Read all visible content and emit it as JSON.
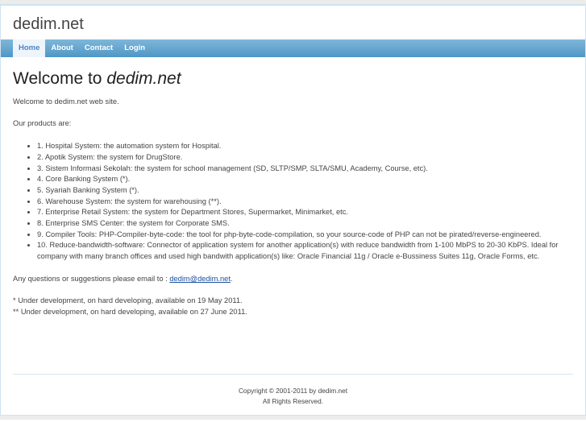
{
  "site": {
    "title": "dedim.net"
  },
  "nav": [
    {
      "label": "Home",
      "active": true
    },
    {
      "label": "About"
    },
    {
      "label": "Contact"
    },
    {
      "label": "Login"
    }
  ],
  "page": {
    "heading_prefix": "Welcome to",
    "heading_em": "dedim.net",
    "intro": "Welcome to dedim.net web site.",
    "products_label": "Our products are:",
    "products": [
      "1. Hospital System: the automation system for Hospital.",
      "2. Apotik System: the system for DrugStore.",
      "3. Sistem Informasi Sekolah: the system for school management (SD, SLTP/SMP, SLTA/SMU, Academy, Course, etc).",
      "4. Core Banking System (*).",
      "5. Syariah Banking System (*).",
      "6. Warehouse System: the system for warehousing (**).",
      "7. Enterprise Retail System: the system for Department Stores, Supermarket, Minimarket, etc.",
      "8. Enterprise SMS Center: the system for Corporate SMS.",
      "9. Compiler Tools: PHP-Compiler-byte-code: the tool for php-byte-code-compilation, so your source-code of PHP can not be pirated/reverse-engineered.",
      "10. Reduce-bandwidth-software: Connector of application system for another application(s) with reduce bandwidth from 1-100 MbPS to 20-30 KbPS. Ideal for company with many branch offices and used high bandwith application(s) like: Oracle Financial 11g / Oracle e-Bussiness Suites 11g, Oracle Forms, etc."
    ],
    "contact_text": "Any questions or suggestions please email to :",
    "contact_email": "dedim@dedim.net",
    "contact_end": ".",
    "note1": "* Under development, on hard developing, available on 19 May 2011.",
    "note2": "** Under development, on hard developing, available on 27 June 2011."
  },
  "footer": {
    "copyright": "Copyright © 2001-2011 by dedim.net",
    "rights": "All Rights Reserved."
  }
}
